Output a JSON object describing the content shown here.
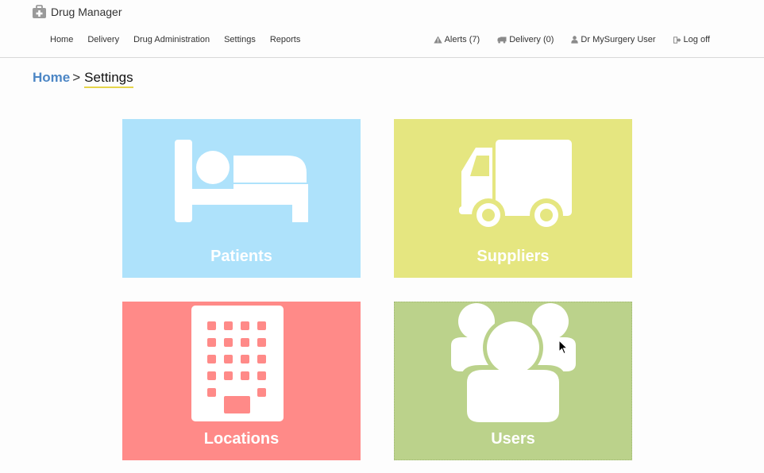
{
  "app": {
    "title": "Drug Manager",
    "icon": "medical-kit-icon"
  },
  "nav": {
    "items": [
      "Home",
      "Delivery",
      "Drug Administration",
      "Settings",
      "Reports"
    ]
  },
  "right_nav": {
    "alerts": "Alerts (7)",
    "delivery": "Delivery (0)",
    "user": "Dr MySurgery User",
    "logoff": "Log off"
  },
  "breadcrumb": {
    "home": "Home",
    "separator": ">",
    "current": "Settings"
  },
  "tiles": [
    {
      "label": "Patients",
      "icon": "bed-icon",
      "color": "#aee2fb"
    },
    {
      "label": "Suppliers",
      "icon": "truck-icon",
      "color": "#e5e680"
    },
    {
      "label": "Locations",
      "icon": "building-icon",
      "color": "#ff8a88"
    },
    {
      "label": "Users",
      "icon": "users-icon",
      "color": "#bbd28b"
    }
  ],
  "colors": {
    "link": "#4c86c5",
    "breadcrumb_underline": "#e6d54a"
  }
}
